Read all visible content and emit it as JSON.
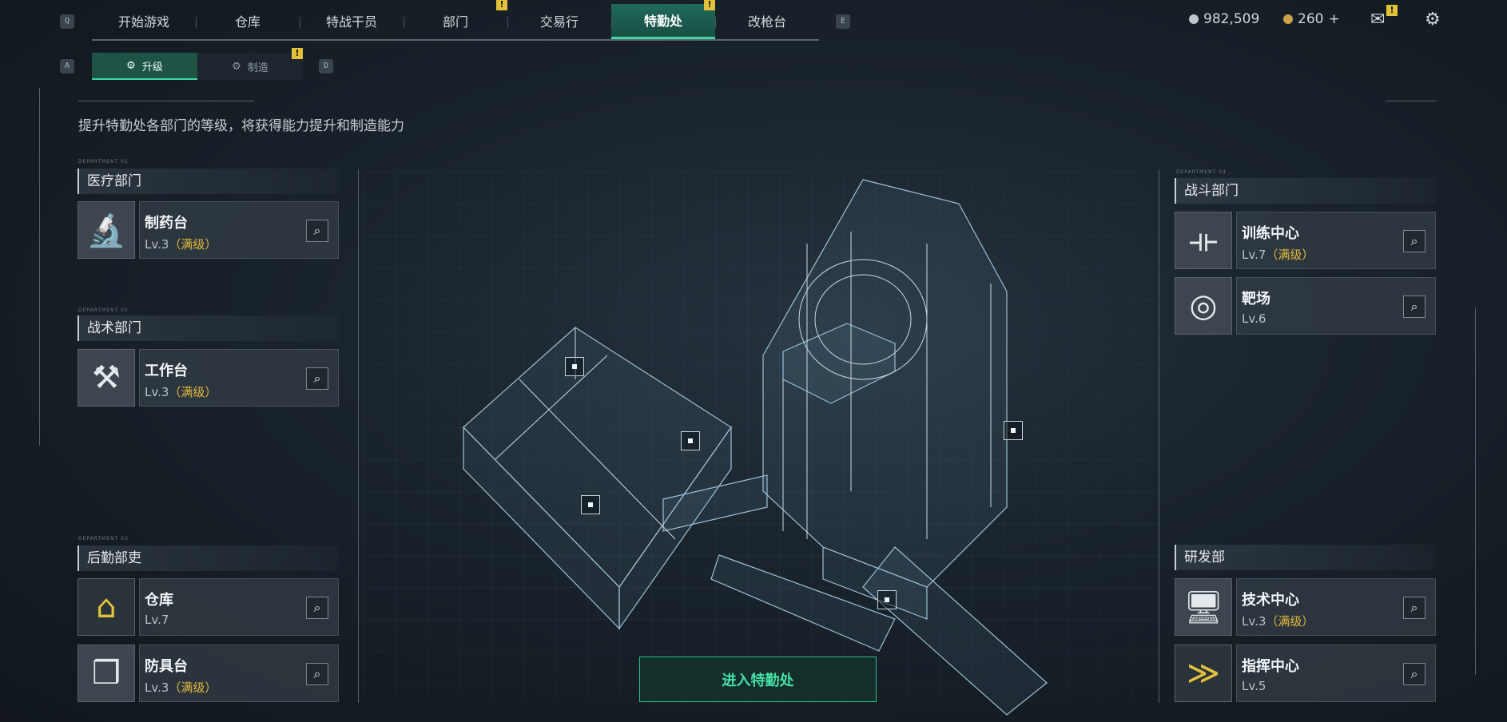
{
  "keys": {
    "q": "Q",
    "e": "E",
    "a": "A",
    "d": "D"
  },
  "topnav": {
    "tabs": [
      {
        "label": "开始游戏",
        "alert": false
      },
      {
        "label": "仓库",
        "alert": false
      },
      {
        "label": "特战干员",
        "alert": false
      },
      {
        "label": "部门",
        "alert": true
      },
      {
        "label": "交易行",
        "alert": false
      },
      {
        "label": "特勤处",
        "alert": true,
        "active": true
      },
      {
        "label": "改枪台",
        "alert": false
      }
    ],
    "alert_glyph": "!"
  },
  "currency": {
    "silver": "982,509",
    "gold": "260",
    "gold_plus": "+",
    "silver_color": "#bfc6cc",
    "gold_color": "#c9a24a"
  },
  "subtabs": [
    {
      "label": "升级",
      "icon": "upgrade-icon",
      "active": true
    },
    {
      "label": "制造",
      "icon": "craft-icon",
      "active": false,
      "alert": true
    }
  ],
  "description": "提升特勤处各部门的等级，将获得能力提升和制造能力",
  "departments": {
    "medical": {
      "tag": "DEPARTMENT 01",
      "title": "医疗部门",
      "items": [
        {
          "name": "制药台",
          "level": "Lv.3",
          "max": "（满级）",
          "icon": "microscope-icon"
        }
      ]
    },
    "tactical": {
      "tag": "DEPARTMENT 02",
      "title": "战术部门",
      "items": [
        {
          "name": "工作台",
          "level": "Lv.3",
          "max": "（满级）",
          "icon": "tools-icon"
        }
      ]
    },
    "logistics": {
      "tag": "DEPARTMENT 03",
      "title": "后勤部吏",
      "items": [
        {
          "name": "仓库",
          "level": "Lv.7",
          "max": "",
          "icon": "warehouse-icon"
        },
        {
          "name": "防具台",
          "level": "Lv.3",
          "max": "（满级）",
          "icon": "cubes-icon"
        }
      ]
    },
    "combat": {
      "tag": "DEPARTMENT 04",
      "title": "战斗部门",
      "items": [
        {
          "name": "训练中心",
          "level": "Lv.7",
          "max": "（满级）",
          "icon": "dumbbell-icon"
        },
        {
          "name": "靶场",
          "level": "Lv.6",
          "max": "",
          "icon": "target-icon"
        }
      ]
    },
    "research": {
      "title": "研发部",
      "items": [
        {
          "name": "技术中心",
          "level": "Lv.3",
          "max": "（满级）",
          "icon": "computer-icon"
        },
        {
          "name": "指挥中心",
          "level": "Lv.5",
          "max": "",
          "icon": "chevron-rank-icon"
        }
      ]
    }
  },
  "enter_button": "进入特勤处",
  "accent": "#3fd6a4"
}
